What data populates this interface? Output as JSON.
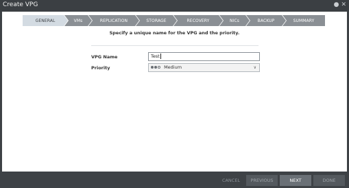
{
  "window": {
    "title": "Create VPG"
  },
  "wizard": {
    "steps": [
      {
        "label": "GENERAL",
        "active": true
      },
      {
        "label": "VMs",
        "active": false
      },
      {
        "label": "REPLICATION",
        "active": false
      },
      {
        "label": "STORAGE",
        "active": false
      },
      {
        "label": "RECOVERY",
        "active": false
      },
      {
        "label": "NICs",
        "active": false
      },
      {
        "label": "BACKUP",
        "active": false
      },
      {
        "label": "SUMMARY",
        "active": false
      }
    ]
  },
  "form": {
    "subtitle": "Specify a unique name for the VPG and the priority.",
    "vpg_name_label": "VPG Name",
    "vpg_name_value": "Test",
    "priority_label": "Priority",
    "priority_value": "Medium"
  },
  "footer": {
    "cancel": "CANCEL",
    "previous": "PREVIOUS",
    "next": "NEXT",
    "done": "DONE"
  }
}
